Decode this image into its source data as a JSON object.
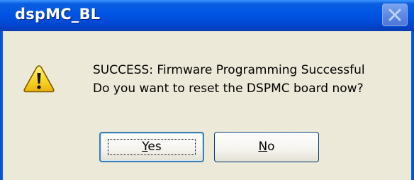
{
  "window": {
    "title": "dspMC_BL"
  },
  "dialog": {
    "icon": "warning-icon",
    "message_lines": [
      "SUCCESS: Firmware Programming Successful",
      "Do you want to reset the DSPMC board now?"
    ]
  },
  "buttons": {
    "yes": {
      "mnemonic": "Y",
      "rest": "es"
    },
    "no": {
      "mnemonic": "N",
      "rest": "o"
    }
  },
  "colors": {
    "titlebar": "#0055e5",
    "dialog_bg": "#ECE9D8",
    "warning_fill": "#f8d420"
  }
}
